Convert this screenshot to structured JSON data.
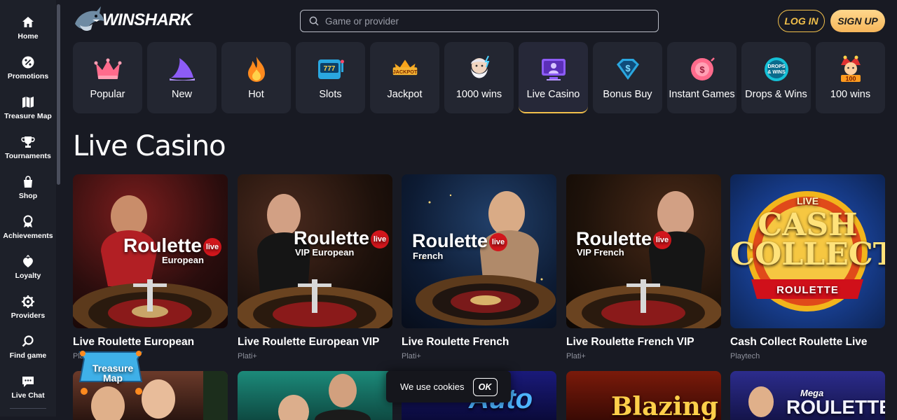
{
  "brand": {
    "name": "WINSHARK"
  },
  "sidebar": {
    "items": [
      {
        "label": "Home",
        "icon": "home-icon"
      },
      {
        "label": "Promotions",
        "icon": "percent-icon"
      },
      {
        "label": "Treasure Map",
        "icon": "map-icon"
      },
      {
        "label": "Tournaments",
        "icon": "trophy-icon"
      },
      {
        "label": "Shop",
        "icon": "shop-bag-icon"
      },
      {
        "label": "Achievements",
        "icon": "medal-icon"
      },
      {
        "label": "Loyalty",
        "icon": "loyalty-icon"
      },
      {
        "label": "Providers",
        "icon": "gear-icon"
      },
      {
        "label": "Find game",
        "icon": "search-icon"
      },
      {
        "label": "Live Chat",
        "icon": "chat-icon"
      }
    ]
  },
  "header": {
    "search_placeholder": "Game or provider",
    "login_label": "LOG IN",
    "signup_label": "SIGN UP"
  },
  "categories": [
    {
      "label": "Popular",
      "icon": "crown-icon"
    },
    {
      "label": "New",
      "icon": "shark-fin-icon"
    },
    {
      "label": "Hot",
      "icon": "flame-icon"
    },
    {
      "label": "Slots",
      "icon": "slot-machine-icon"
    },
    {
      "label": "Jackpot",
      "icon": "jackpot-crown-icon"
    },
    {
      "label": "1000 wins",
      "icon": "zeus-icon"
    },
    {
      "label": "Live Casino",
      "icon": "live-dealer-icon",
      "active": true
    },
    {
      "label": "Bonus Buy",
      "icon": "diamond-dollar-icon"
    },
    {
      "label": "Instant Games",
      "icon": "instant-games-icon"
    },
    {
      "label": "Drops & Wins",
      "icon": "drops-wins-icon"
    },
    {
      "label": "100 wins",
      "icon": "jester-icon"
    }
  ],
  "section": {
    "title": "Live Casino"
  },
  "games": [
    {
      "name": "Live Roulette European",
      "provider": "Plati+",
      "thumb_title": "Roulette",
      "thumb_sub": "European",
      "thumb_live": "live"
    },
    {
      "name": "Live Roulette European VIP",
      "provider": "Plati+",
      "thumb_title": "Roulette",
      "thumb_sub": "VIP European",
      "thumb_live": "live"
    },
    {
      "name": "Live Roulette French",
      "provider": "Plati+",
      "thumb_title": "Roulette",
      "thumb_sub": "French",
      "thumb_live": "live"
    },
    {
      "name": "Live Roulette French VIP",
      "provider": "Plati+",
      "thumb_title": "Roulette",
      "thumb_sub": "VIP French",
      "thumb_live": "live"
    },
    {
      "name": "Cash Collect Roulette Live",
      "provider": "Playtech",
      "thumb_top": "LIVE",
      "thumb_title": "CASH COLLECT",
      "thumb_sub": "ROULETTE"
    }
  ],
  "row2": [
    {
      "thumb_text": ""
    },
    {
      "thumb_text": ""
    },
    {
      "thumb_text": "Auto"
    },
    {
      "thumb_text": "Blazing"
    },
    {
      "thumb_text": "ROULETTE",
      "thumb_top": "Mega"
    }
  ],
  "treasure_badge": {
    "line1": "Treasure",
    "line2": "Map"
  },
  "cookie": {
    "text": "We use cookies",
    "ok_label": "OK"
  },
  "colors": {
    "accent": "#f2c04b",
    "background": "#181a23",
    "panel": "#232631"
  }
}
